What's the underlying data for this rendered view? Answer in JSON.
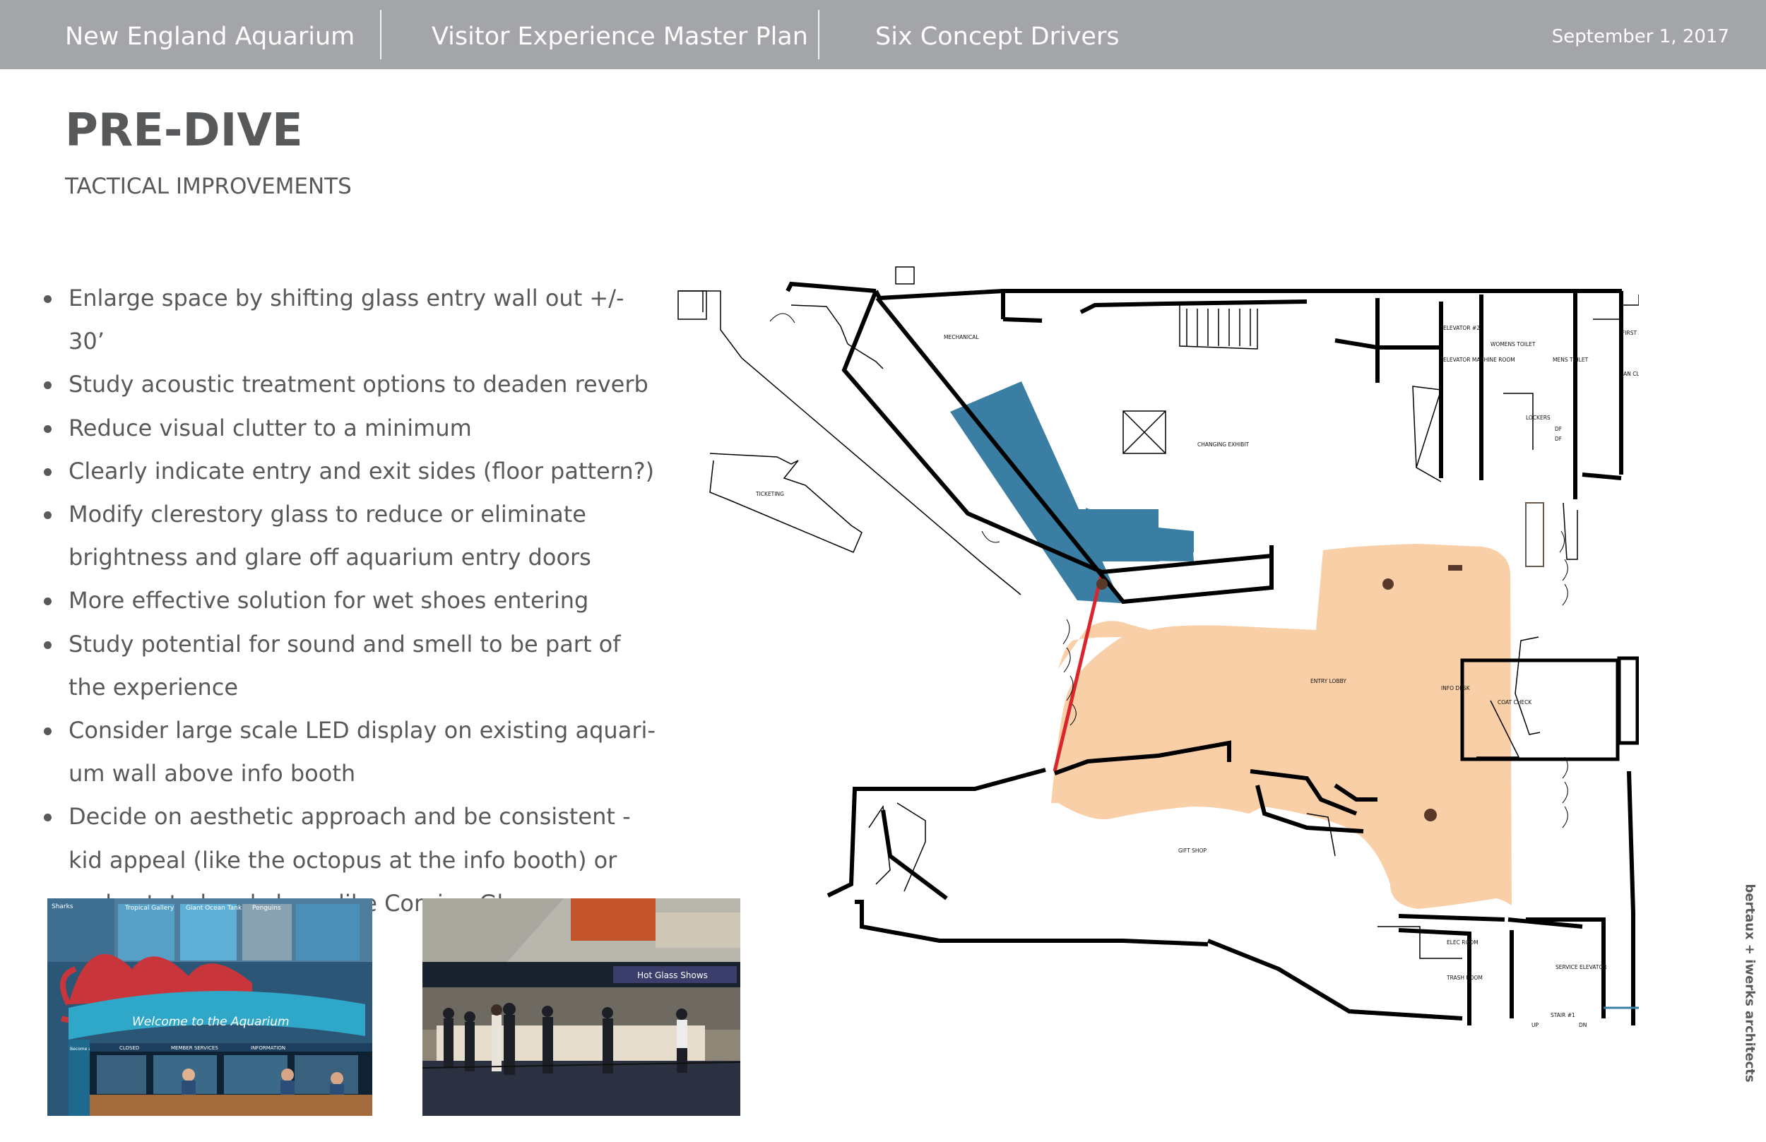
{
  "header": {
    "org": "New England Aquarium",
    "project": "Visitor Experience Master Plan",
    "section": "Six Concept Drivers",
    "date": "September 1, 2017"
  },
  "title": "PRE-DIVE",
  "subtitle": "TACTICAL IMPROVEMENTS",
  "bullets": [
    [
      "Enlarge space by shifting glass entry wall out +/- 30’"
    ],
    [
      "Study acoustic treatment options to deaden reverb"
    ],
    [
      "Reduce visual clutter to a minimum"
    ],
    [
      "Clearly indicate entry and exit sides (floor pattern?)"
    ],
    [
      "Modify clerestory glass to reduce or eliminate",
      "brightness and glare off aquarium entry doors"
    ],
    [
      "More effective solution for wet shoes entering"
    ],
    [
      "Study potential for sound and smell to be part of",
      "the experience"
    ],
    [
      "Consider large scale LED display on existing aquari-",
      "um wall above info booth"
    ],
    [
      "Decide on aesthetic approach and be consistent -",
      "kid appeal (like the octopus at the info booth) or",
      "understated and clean, like Corning Glass"
    ]
  ],
  "photos": {
    "aquarium_signs": [
      "Sharks",
      "Tropical Gallery",
      "Giant Ocean Tank",
      "Penguins",
      "Welcome to the Aquarium",
      "Become a Member Today!",
      "CLOSED",
      "MEMBER SERVICES",
      "INFORMATION"
    ],
    "corning_sign": "Hot Glass Shows"
  },
  "plan": {
    "rooms": {
      "mechanical": "MECHANICAL",
      "elevator": "ELEVATOR #2",
      "elevator_machine": "ELEVATOR MACHINE ROOM",
      "womens": "WOMENS TOILET",
      "mens": "MENS TOILET",
      "first_aid": "FIRST AID",
      "jan_closet": "JAN CLOS",
      "lockers": "LOCKERS",
      "changing_exhibit": "CHANGING EXHIBIT",
      "ticketing": "TICKETING",
      "entry_lobby": "ENTRY LOBBY",
      "info_desk": "INFO DESK",
      "coat_check": "COAT CHECK",
      "gift_shop": "GIFT SHOP",
      "elec_room": "ELEC ROOM",
      "trash_room": "TRASH ROOM",
      "service_elevator": "SERVICE ELEVATOR",
      "stair": "STAIR #1",
      "up": "UP",
      "dn": "DN",
      "df": "DF"
    },
    "colors": {
      "lobby": "#f9cfa8",
      "exhibit": "#3a7fa3",
      "entry_wall": "#d9262c"
    }
  },
  "credit": "bertaux + iwerks architects"
}
